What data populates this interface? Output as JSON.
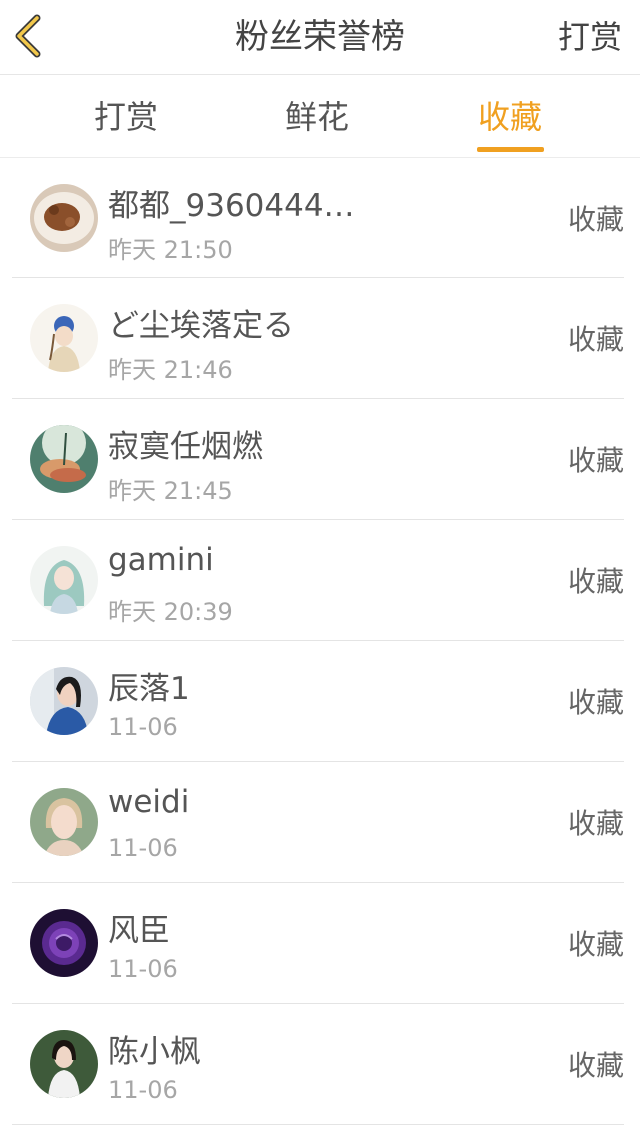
{
  "header": {
    "title": "粉丝荣誉榜",
    "right_button": "打赏",
    "back_icon": "chevron-left-icon",
    "accent_color": "#f0a020"
  },
  "tabs": [
    {
      "label": "打赏",
      "active": false
    },
    {
      "label": "鲜花",
      "active": false
    },
    {
      "label": "收藏",
      "active": true
    }
  ],
  "fans": [
    {
      "name": "都都_9360444…",
      "time": "昨天 21:50",
      "action": "收藏",
      "avatar": "coffee-cup-avatar"
    },
    {
      "name": "ど尘埃落定る",
      "time": "昨天 21:46",
      "action": "收藏",
      "avatar": "anime-girl-avatar"
    },
    {
      "name": "寂寞任烟燃",
      "time": "昨天 21:45",
      "action": "收藏",
      "avatar": "flower-avatar"
    },
    {
      "name": "gamini",
      "time": "昨天 20:39",
      "action": "收藏",
      "avatar": "illustrated-girl-avatar"
    },
    {
      "name": "辰落1",
      "time": "11-06",
      "action": "收藏",
      "avatar": "portrait-avatar"
    },
    {
      "name": "weidi",
      "time": "11-06",
      "action": "收藏",
      "avatar": "woman-face-avatar"
    },
    {
      "name": "风臣",
      "time": "11-06",
      "action": "收藏",
      "avatar": "purple-rose-avatar"
    },
    {
      "name": "陈小枫",
      "time": "11-06",
      "action": "收藏",
      "avatar": "girl-photo-avatar"
    }
  ]
}
